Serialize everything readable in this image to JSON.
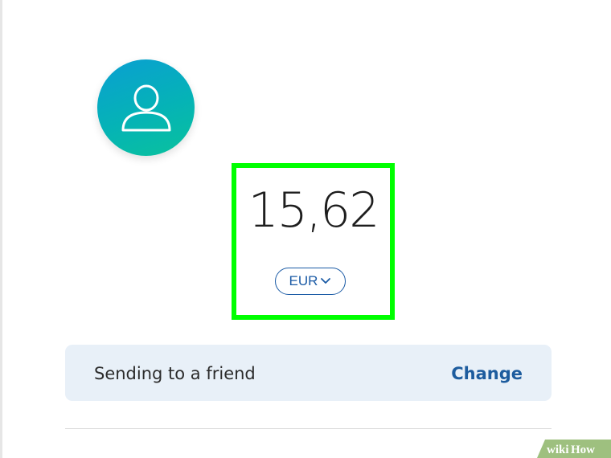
{
  "recipient": {
    "avatar_icon": "user-icon"
  },
  "payment": {
    "amount": "15,62",
    "currency": "EUR",
    "currency_icon": "chevron-down-icon"
  },
  "sending": {
    "label": "Sending to a friend",
    "change_label": "Change"
  },
  "watermark": {
    "text": "wikiHow"
  },
  "colors": {
    "highlight": "#00ff00",
    "link": "#1d5c9e",
    "panel": "#e8f0f8",
    "avatar_gradient_start": "#0a9fd2",
    "avatar_gradient_end": "#09c29c"
  }
}
